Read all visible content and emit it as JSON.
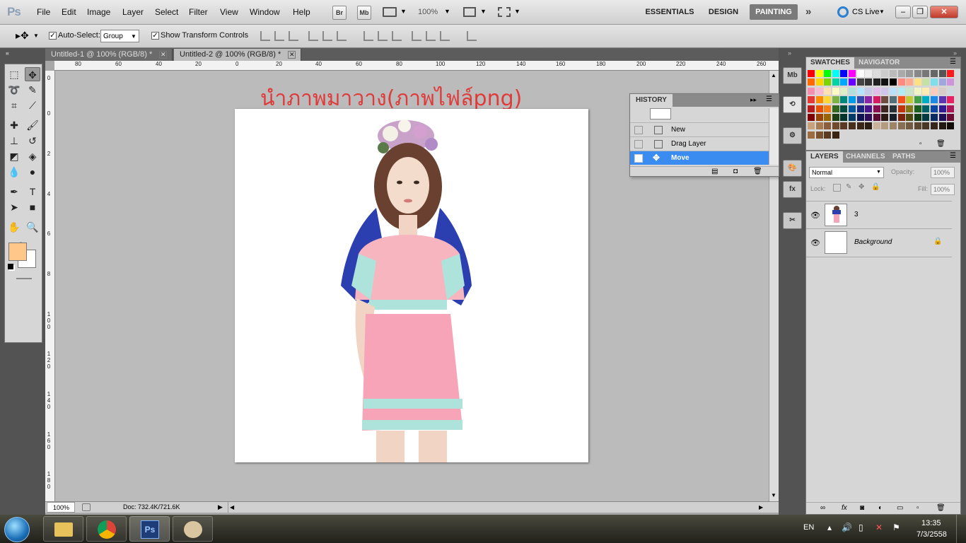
{
  "app": {
    "logo": "Ps"
  },
  "menu": [
    "File",
    "Edit",
    "Image",
    "Layer",
    "Select",
    "Filter",
    "View",
    "Window",
    "Help"
  ],
  "appbar": {
    "bridge": "Br",
    "minibridge": "Mb",
    "zoom": "100%"
  },
  "workspaces": {
    "essentials": "ESSENTIALS",
    "design": "DESIGN",
    "painting": "PAINTING",
    "cslive": "CS Live"
  },
  "options": {
    "auto_select_label": "Auto-Select:",
    "auto_select_checked": true,
    "auto_select_value": "Group",
    "show_transform_label": "Show Transform Controls",
    "show_transform_checked": true
  },
  "tabs": [
    {
      "label": "Untitled-1 @ 100% (RGB/8) *",
      "active": false
    },
    {
      "label": "Untitled-2 @ 100% (RGB/8) *",
      "active": true
    }
  ],
  "ruler_top": [
    "80",
    "60",
    "40",
    "20",
    "0",
    "20",
    "40",
    "60",
    "80",
    "100",
    "120",
    "140",
    "160",
    "180",
    "200",
    "220",
    "240",
    "260"
  ],
  "ruler_left": [
    "0",
    "0",
    "2",
    "4",
    "6",
    "8",
    "1 0 0",
    "1 2 0",
    "1 4 0",
    "1 6 0",
    "1 8 0"
  ],
  "canvas": {
    "annotation": "นำภาพมาวาง(ภาพไฟล์png)"
  },
  "status": {
    "zoom": "100%",
    "doc": "Doc: 732.4K/721.6K"
  },
  "colors": {
    "foreground": "#ffc88a",
    "background": "#ffffff",
    "selection": "#3b8cf0",
    "accent_red": "#e03a3a"
  },
  "history": {
    "title": "HISTORY",
    "items": [
      {
        "label": "New",
        "selected": false
      },
      {
        "label": "Drag Layer",
        "selected": false
      },
      {
        "label": "Move",
        "selected": true
      }
    ]
  },
  "swatches_panel": {
    "tabs": [
      "SWATCHES",
      "NAVIGATOR"
    ]
  },
  "layers_panel": {
    "tabs": [
      "LAYERS",
      "CHANNELS",
      "PATHS"
    ],
    "blend_mode": "Normal",
    "opacity_label": "Opacity:",
    "opacity": "100%",
    "lock_label": "Lock:",
    "fill_label": "Fill:",
    "fill": "100%",
    "layers": [
      {
        "name": "3",
        "italic": false,
        "locked": false
      },
      {
        "name": "Background",
        "italic": true,
        "locked": true
      }
    ]
  },
  "taskbar": {
    "lang": "EN",
    "time": "13:35",
    "date": "7/3/2558"
  }
}
